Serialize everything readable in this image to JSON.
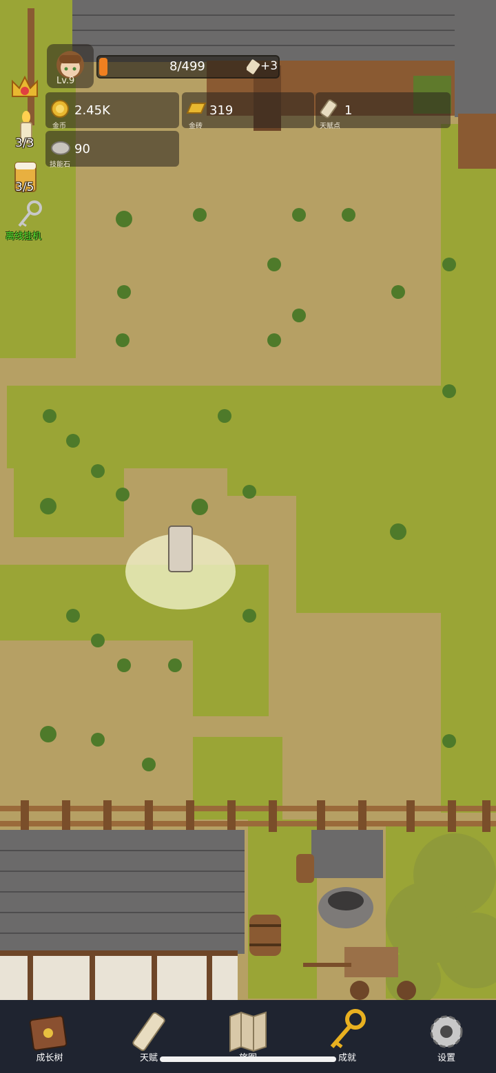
{
  "player": {
    "level": "Lv.9"
  },
  "experience": {
    "text": "8/499",
    "fraction": 0.016
  },
  "talent_bonus": {
    "text": "+3"
  },
  "resources": {
    "gold": {
      "value": "2.45K",
      "label": "金币"
    },
    "bars": {
      "value": "319",
      "label": "金砖"
    },
    "talent": {
      "value": "1",
      "label": "天赋点"
    },
    "stone": {
      "value": "90",
      "label": "技能石"
    }
  },
  "side": {
    "candle_count": "3/3",
    "beer_count": "3/5",
    "idle_label": "离线挂机"
  },
  "nav": {
    "items": [
      {
        "label": "成长树",
        "icon": "book-icon"
      },
      {
        "label": "天赋",
        "icon": "scroll-icon"
      },
      {
        "label": "旅图",
        "icon": "map-icon"
      },
      {
        "label": "成就",
        "icon": "key-icon"
      },
      {
        "label": "设置",
        "icon": "gear-icon"
      }
    ]
  },
  "colors": {
    "grass": "#9aa536",
    "dirt": "#b6a064",
    "roof": "#6b6a6a",
    "wood": "#8a5a32",
    "nav_bg": "#1f2430",
    "exp_fill": "#f08020",
    "idle_green": "#55e030"
  }
}
